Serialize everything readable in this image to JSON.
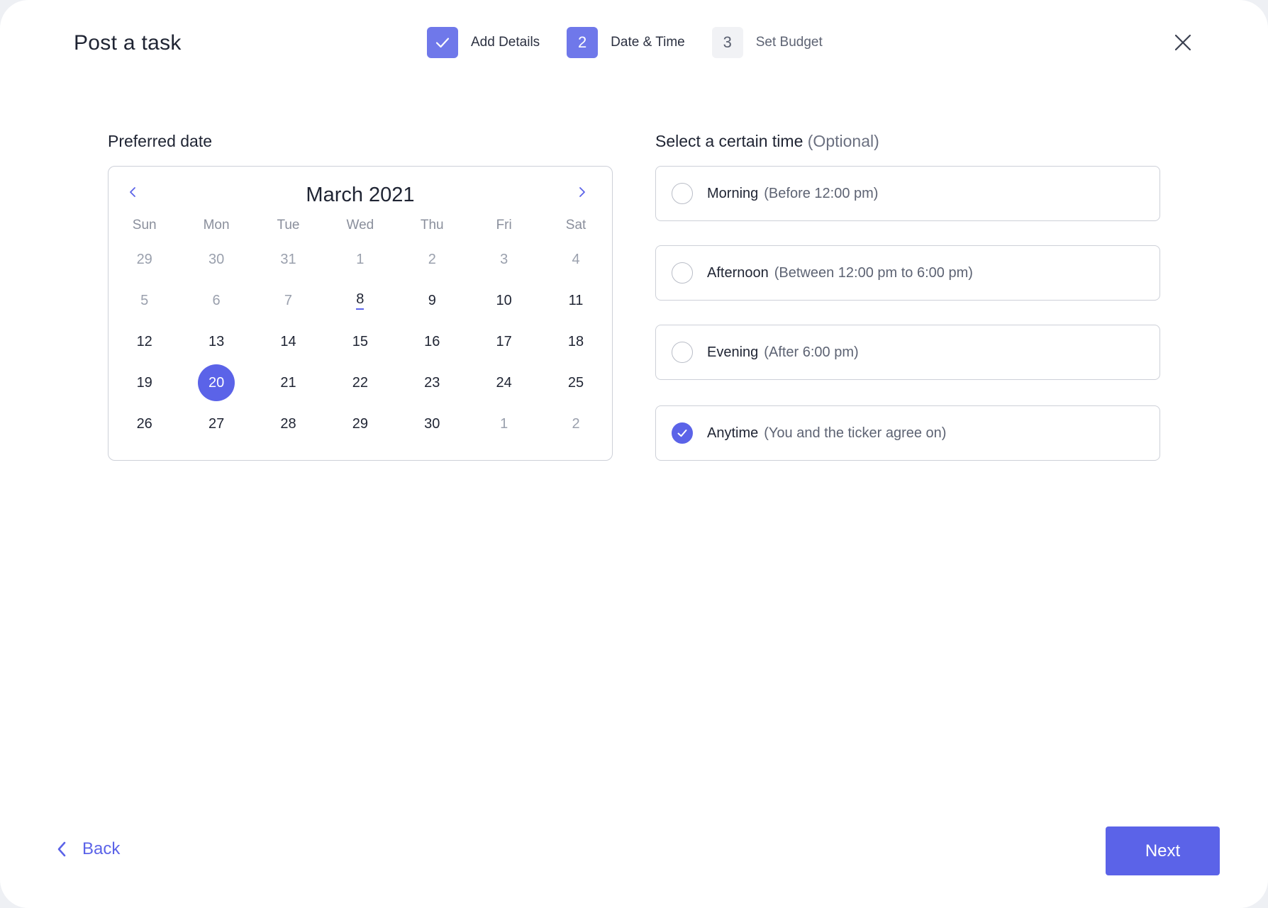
{
  "header": {
    "title": "Post a task",
    "close_icon": "close-icon"
  },
  "steps": [
    {
      "number": "",
      "label": "Add Details",
      "state": "done",
      "icon": "check-icon"
    },
    {
      "number": "2",
      "label": "Date & Time",
      "state": "active"
    },
    {
      "number": "3",
      "label": "Set Budget",
      "state": "pending"
    }
  ],
  "date_section": {
    "label": "Preferred date",
    "month_title": "March 2021",
    "prev_icon": "chevron-left-icon",
    "next_icon": "chevron-right-icon",
    "weekdays": [
      "Sun",
      "Mon",
      "Tue",
      "Wed",
      "Thu",
      "Fri",
      "Sat"
    ],
    "weeks": [
      [
        {
          "d": "29",
          "s": "out"
        },
        {
          "d": "30",
          "s": "out"
        },
        {
          "d": "31",
          "s": "out"
        },
        {
          "d": "1",
          "s": "out"
        },
        {
          "d": "2",
          "s": "out"
        },
        {
          "d": "3",
          "s": "out"
        },
        {
          "d": "4",
          "s": "out"
        }
      ],
      [
        {
          "d": "5",
          "s": "out"
        },
        {
          "d": "6",
          "s": "out"
        },
        {
          "d": "7",
          "s": "out"
        },
        {
          "d": "8",
          "s": "today"
        },
        {
          "d": "9",
          "s": "in"
        },
        {
          "d": "10",
          "s": "in"
        },
        {
          "d": "11",
          "s": "in"
        }
      ],
      [
        {
          "d": "12",
          "s": "in"
        },
        {
          "d": "13",
          "s": "in"
        },
        {
          "d": "14",
          "s": "in"
        },
        {
          "d": "15",
          "s": "in"
        },
        {
          "d": "16",
          "s": "in"
        },
        {
          "d": "17",
          "s": "in"
        },
        {
          "d": "18",
          "s": "in"
        }
      ],
      [
        {
          "d": "19",
          "s": "in"
        },
        {
          "d": "20",
          "s": "selected"
        },
        {
          "d": "21",
          "s": "in"
        },
        {
          "d": "22",
          "s": "in"
        },
        {
          "d": "23",
          "s": "in"
        },
        {
          "d": "24",
          "s": "in"
        },
        {
          "d": "25",
          "s": "in"
        }
      ],
      [
        {
          "d": "26",
          "s": "in"
        },
        {
          "d": "27",
          "s": "in"
        },
        {
          "d": "28",
          "s": "in"
        },
        {
          "d": "29",
          "s": "in"
        },
        {
          "d": "30",
          "s": "in"
        },
        {
          "d": "1",
          "s": "out"
        },
        {
          "d": "2",
          "s": "out"
        }
      ]
    ]
  },
  "time_section": {
    "label": "Select a certain time",
    "optional": "(Optional)",
    "options": [
      {
        "name": "Morning",
        "desc": "(Before 12:00 pm)",
        "checked": false
      },
      {
        "name": "Afternoon",
        "desc": "(Between 12:00 pm to 6:00 pm)",
        "checked": false
      },
      {
        "name": "Evening",
        "desc": "(After 6:00 pm)",
        "checked": false
      },
      {
        "name": "Anytime",
        "desc": "(You and the ticker agree on)",
        "checked": true
      }
    ]
  },
  "footer": {
    "back_label": "Back",
    "back_icon": "chevron-left-icon",
    "next_label": "Next"
  },
  "colors": {
    "accent": "#5b63e8",
    "step_badge": "#6f78ea",
    "border": "#cdd0d8"
  }
}
